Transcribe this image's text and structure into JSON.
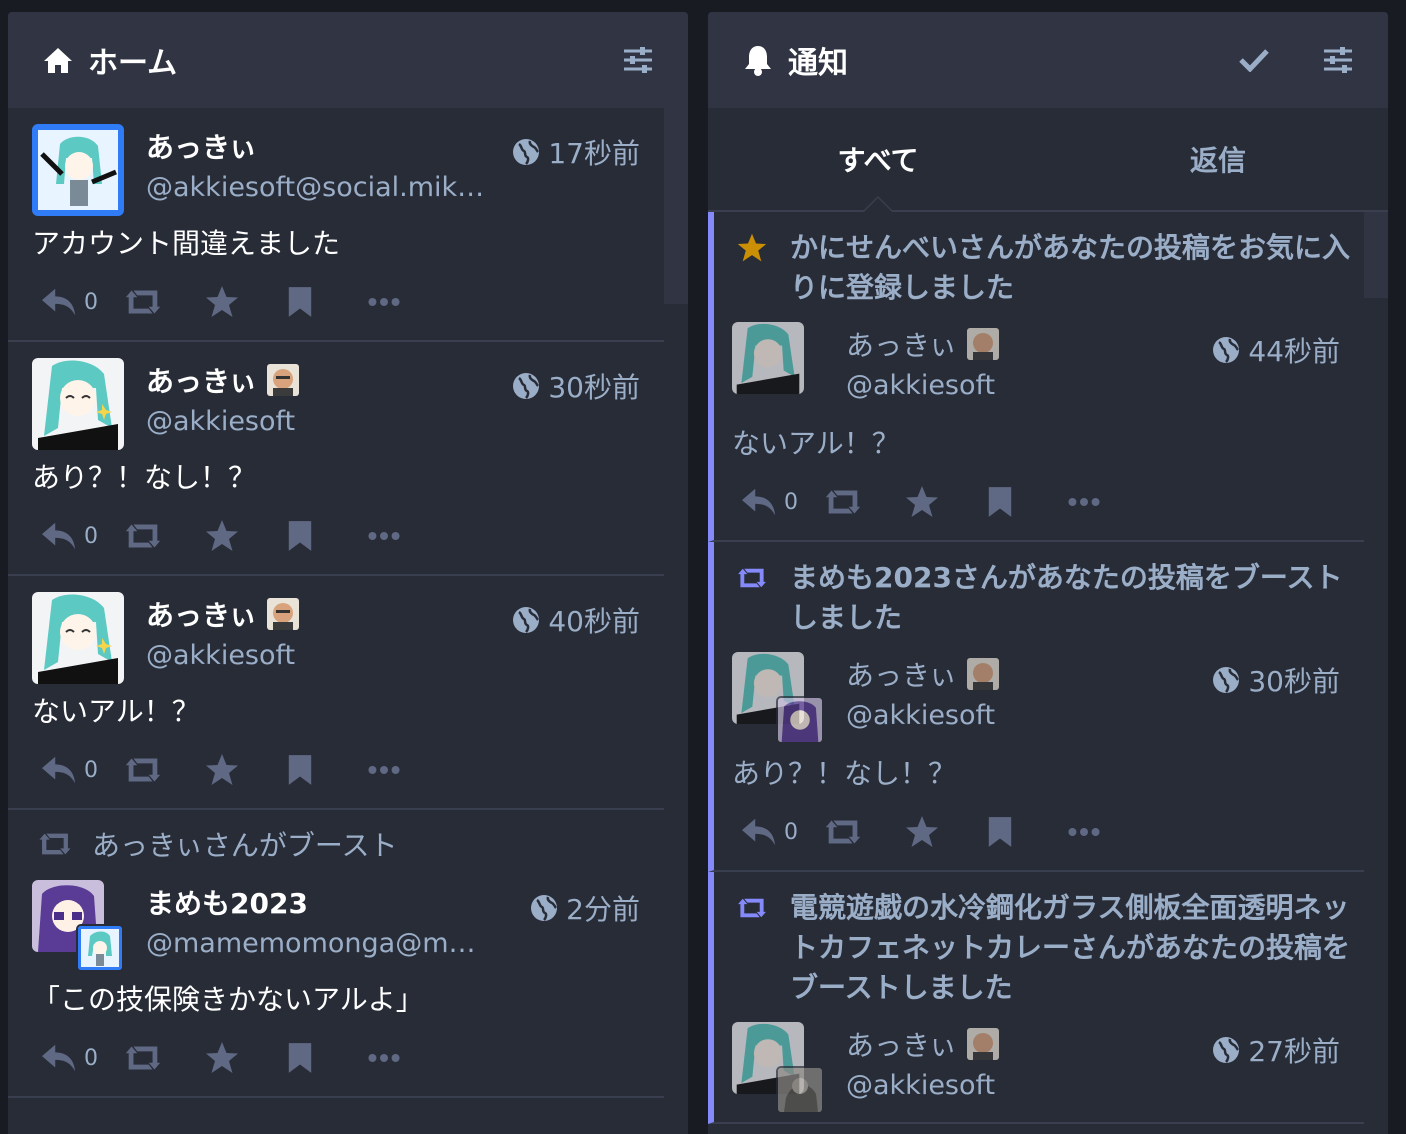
{
  "home": {
    "title": "ホーム",
    "statuses": [
      {
        "display_name": "あっきぃ",
        "acct": "@akkiesoft@social.mik…",
        "time": "17秒前",
        "content": "アカウント間違えました",
        "reply_count": "0",
        "has_emoji": false
      },
      {
        "display_name": "あっきぃ",
        "acct": "@akkiesoft",
        "time": "30秒前",
        "content": "あり？！なし！？",
        "reply_count": "0",
        "has_emoji": true
      },
      {
        "display_name": "あっきぃ",
        "acct": "@akkiesoft",
        "time": "40秒前",
        "content": "ないアル！？",
        "reply_count": "0",
        "has_emoji": true
      },
      {
        "prepend": "あっきぃさんがブースト",
        "display_name": "まめも2023",
        "acct": "@mamemomonga@mo…",
        "time": "2分前",
        "content": "「この技保険きかないアルよ」",
        "reply_count": "0",
        "has_emoji": false
      }
    ]
  },
  "notifications": {
    "title": "通知",
    "tabs": [
      "すべて",
      "返信"
    ],
    "items": [
      {
        "type": "favourite",
        "text": "かにせんべいさんがあなたの投稿をお気に入りに登録しました",
        "display_name": "あっきぃ",
        "acct": "@akkiesoft",
        "time": "44秒前",
        "content": "ないアル！？",
        "reply_count": "0"
      },
      {
        "type": "reblog",
        "text": "まめも2023さんがあなたの投稿をブーストしました",
        "display_name": "あっきぃ",
        "acct": "@akkiesoft",
        "time": "30秒前",
        "content": "あり？！なし！？",
        "reply_count": "0"
      },
      {
        "type": "reblog",
        "text": "電競遊戯の水冷鋼化ガラス側板全面透明ネットカフェネットカレーさんがあなたの投稿をブーストしました",
        "display_name": "あっきぃ",
        "acct": "@akkiesoft",
        "time": "27秒前"
      }
    ]
  },
  "colors": {
    "accent": "#858afa",
    "muted": "#9baec8",
    "icon": "#606984",
    "bg": "#282c37",
    "header": "#313543",
    "star": "#ca8f04"
  }
}
